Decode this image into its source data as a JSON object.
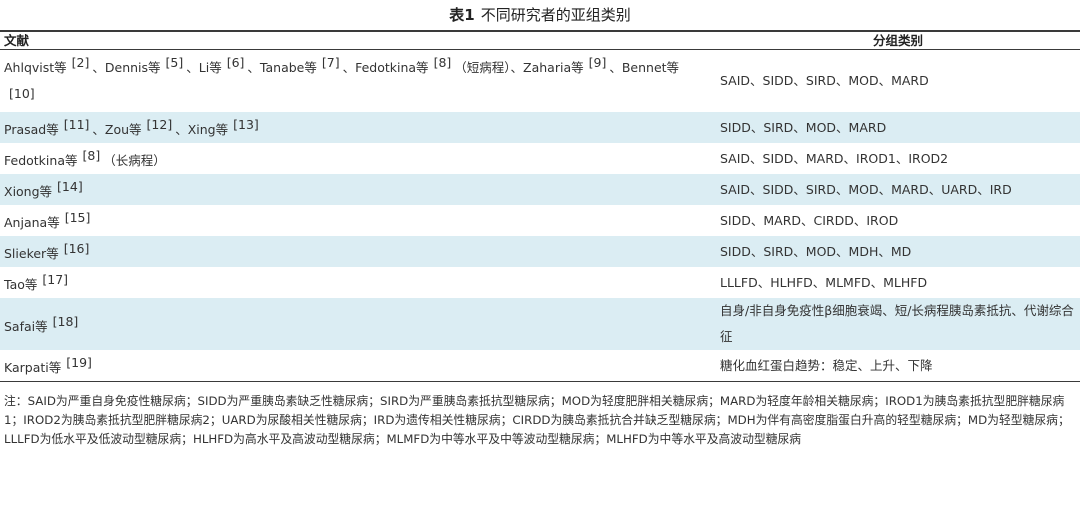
{
  "caption": {
    "number": "表1",
    "title": "不同研究者的亚组类别"
  },
  "table": {
    "headers": [
      "文献",
      "分组类别"
    ],
    "rows": [
      {
        "segments": [
          {
            "text": "Ahlqvist等"
          },
          {
            "ref": "[2]"
          },
          {
            "text": "、Dennis等"
          },
          {
            "ref": "[5]"
          },
          {
            "text": "、Li等"
          },
          {
            "ref": "[6]"
          },
          {
            "text": "、Tanabe等"
          },
          {
            "ref": "[7]"
          },
          {
            "text": "、Fedotkina等"
          },
          {
            "ref": "[8]"
          },
          {
            "text": "（短病程）、Zaharia等"
          },
          {
            "ref": "[9]"
          },
          {
            "text": "、Bennet等"
          },
          {
            "ref": "[10]"
          }
        ],
        "category": "SAID、SIDD、SIRD、MOD、MARD"
      },
      {
        "segments": [
          {
            "text": "Prasad等"
          },
          {
            "ref": "[11]"
          },
          {
            "text": "、Zou等"
          },
          {
            "ref": "[12]"
          },
          {
            "text": "、Xing等"
          },
          {
            "ref": "[13]"
          }
        ],
        "category": "SIDD、SIRD、MOD、MARD"
      },
      {
        "segments": [
          {
            "text": "Fedotkina等"
          },
          {
            "ref": "[8]"
          },
          {
            "text": "（长病程）"
          }
        ],
        "category": "SAID、SIDD、MARD、IROD1、IROD2"
      },
      {
        "segments": [
          {
            "text": "Xiong等"
          },
          {
            "ref": "[14]"
          }
        ],
        "category": "SAID、SIDD、SIRD、MOD、MARD、UARD、IRD"
      },
      {
        "segments": [
          {
            "text": "Anjana等"
          },
          {
            "ref": "[15]"
          }
        ],
        "category": "SIDD、MARD、CIRDD、IROD"
      },
      {
        "segments": [
          {
            "text": "Slieker等"
          },
          {
            "ref": "[16]"
          }
        ],
        "category": "SIDD、SIRD、MOD、MDH、MD"
      },
      {
        "segments": [
          {
            "text": "Tao等"
          },
          {
            "ref": "[17]"
          }
        ],
        "category": "LLLFD、HLHFD、MLMFD、MLHFD"
      },
      {
        "segments": [
          {
            "text": "Safai等"
          },
          {
            "ref": "[18]"
          }
        ],
        "category": "自身/非自身免疫性β细胞衰竭、短/长病程胰岛素抵抗、代谢综合征"
      },
      {
        "segments": [
          {
            "text": "Karpati等"
          },
          {
            "ref": "[19]"
          }
        ],
        "category": "糖化血红蛋白趋势：稳定、上升、下降"
      }
    ]
  },
  "note": "注：SAID为严重自身免疫性糖尿病；SIDD为严重胰岛素缺乏性糖尿病；SIRD为严重胰岛素抵抗型糖尿病；MOD为轻度肥胖相关糖尿病；MARD为轻度年龄相关糖尿病；IROD1为胰岛素抵抗型肥胖糖尿病1；IROD2为胰岛素抵抗型肥胖糖尿病2；UARD为尿酸相关性糖尿病；IRD为遗传相关性糖尿病；CIRDD为胰岛素抵抗合并缺乏型糖尿病；MDH为伴有高密度脂蛋白升高的轻型糖尿病；MD为轻型糖尿病；LLLFD为低水平及低波动型糖尿病；HLHFD为高水平及高波动型糖尿病；MLMFD为中等水平及中等波动型糖尿病；MLHFD为中等水平及高波动型糖尿病"
}
